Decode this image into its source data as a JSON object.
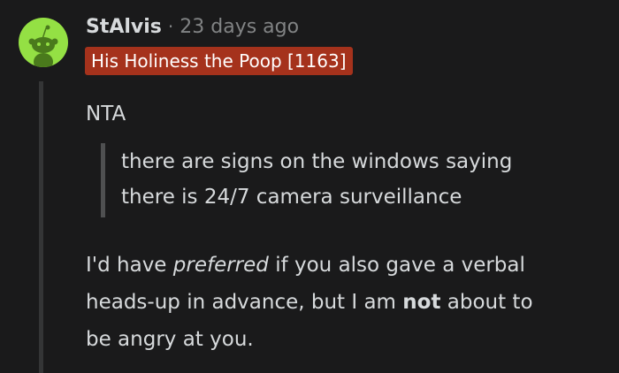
{
  "comment": {
    "username": "StAlvis",
    "separator": "·",
    "timestamp": "23 days ago",
    "flair": "His Holiness the Poop [1163]",
    "verdict": "NTA",
    "quote": {
      "line1": "there are signs on the windows saying",
      "line2": "there is 24/7 camera surveillance"
    },
    "paragraph": {
      "line1_start": "I'd have ",
      "line1_emphasis": "preferred",
      "line1_end": " if you also gave a verbal",
      "line2_start": "heads-up in advance, but I am ",
      "line2_strong": "not",
      "line2_end": " about to",
      "line3": "be angry at you."
    }
  },
  "avatar": {
    "icon": "snoo-avatar-icon",
    "background": "#94e044",
    "figure_color": "#4a7a1c"
  },
  "colors": {
    "background": "#1a1a1b",
    "text": "#d7dadc",
    "muted": "#818384",
    "flair_background": "#a5321c",
    "thread_line": "#343536",
    "quote_bar": "#4f5051"
  }
}
